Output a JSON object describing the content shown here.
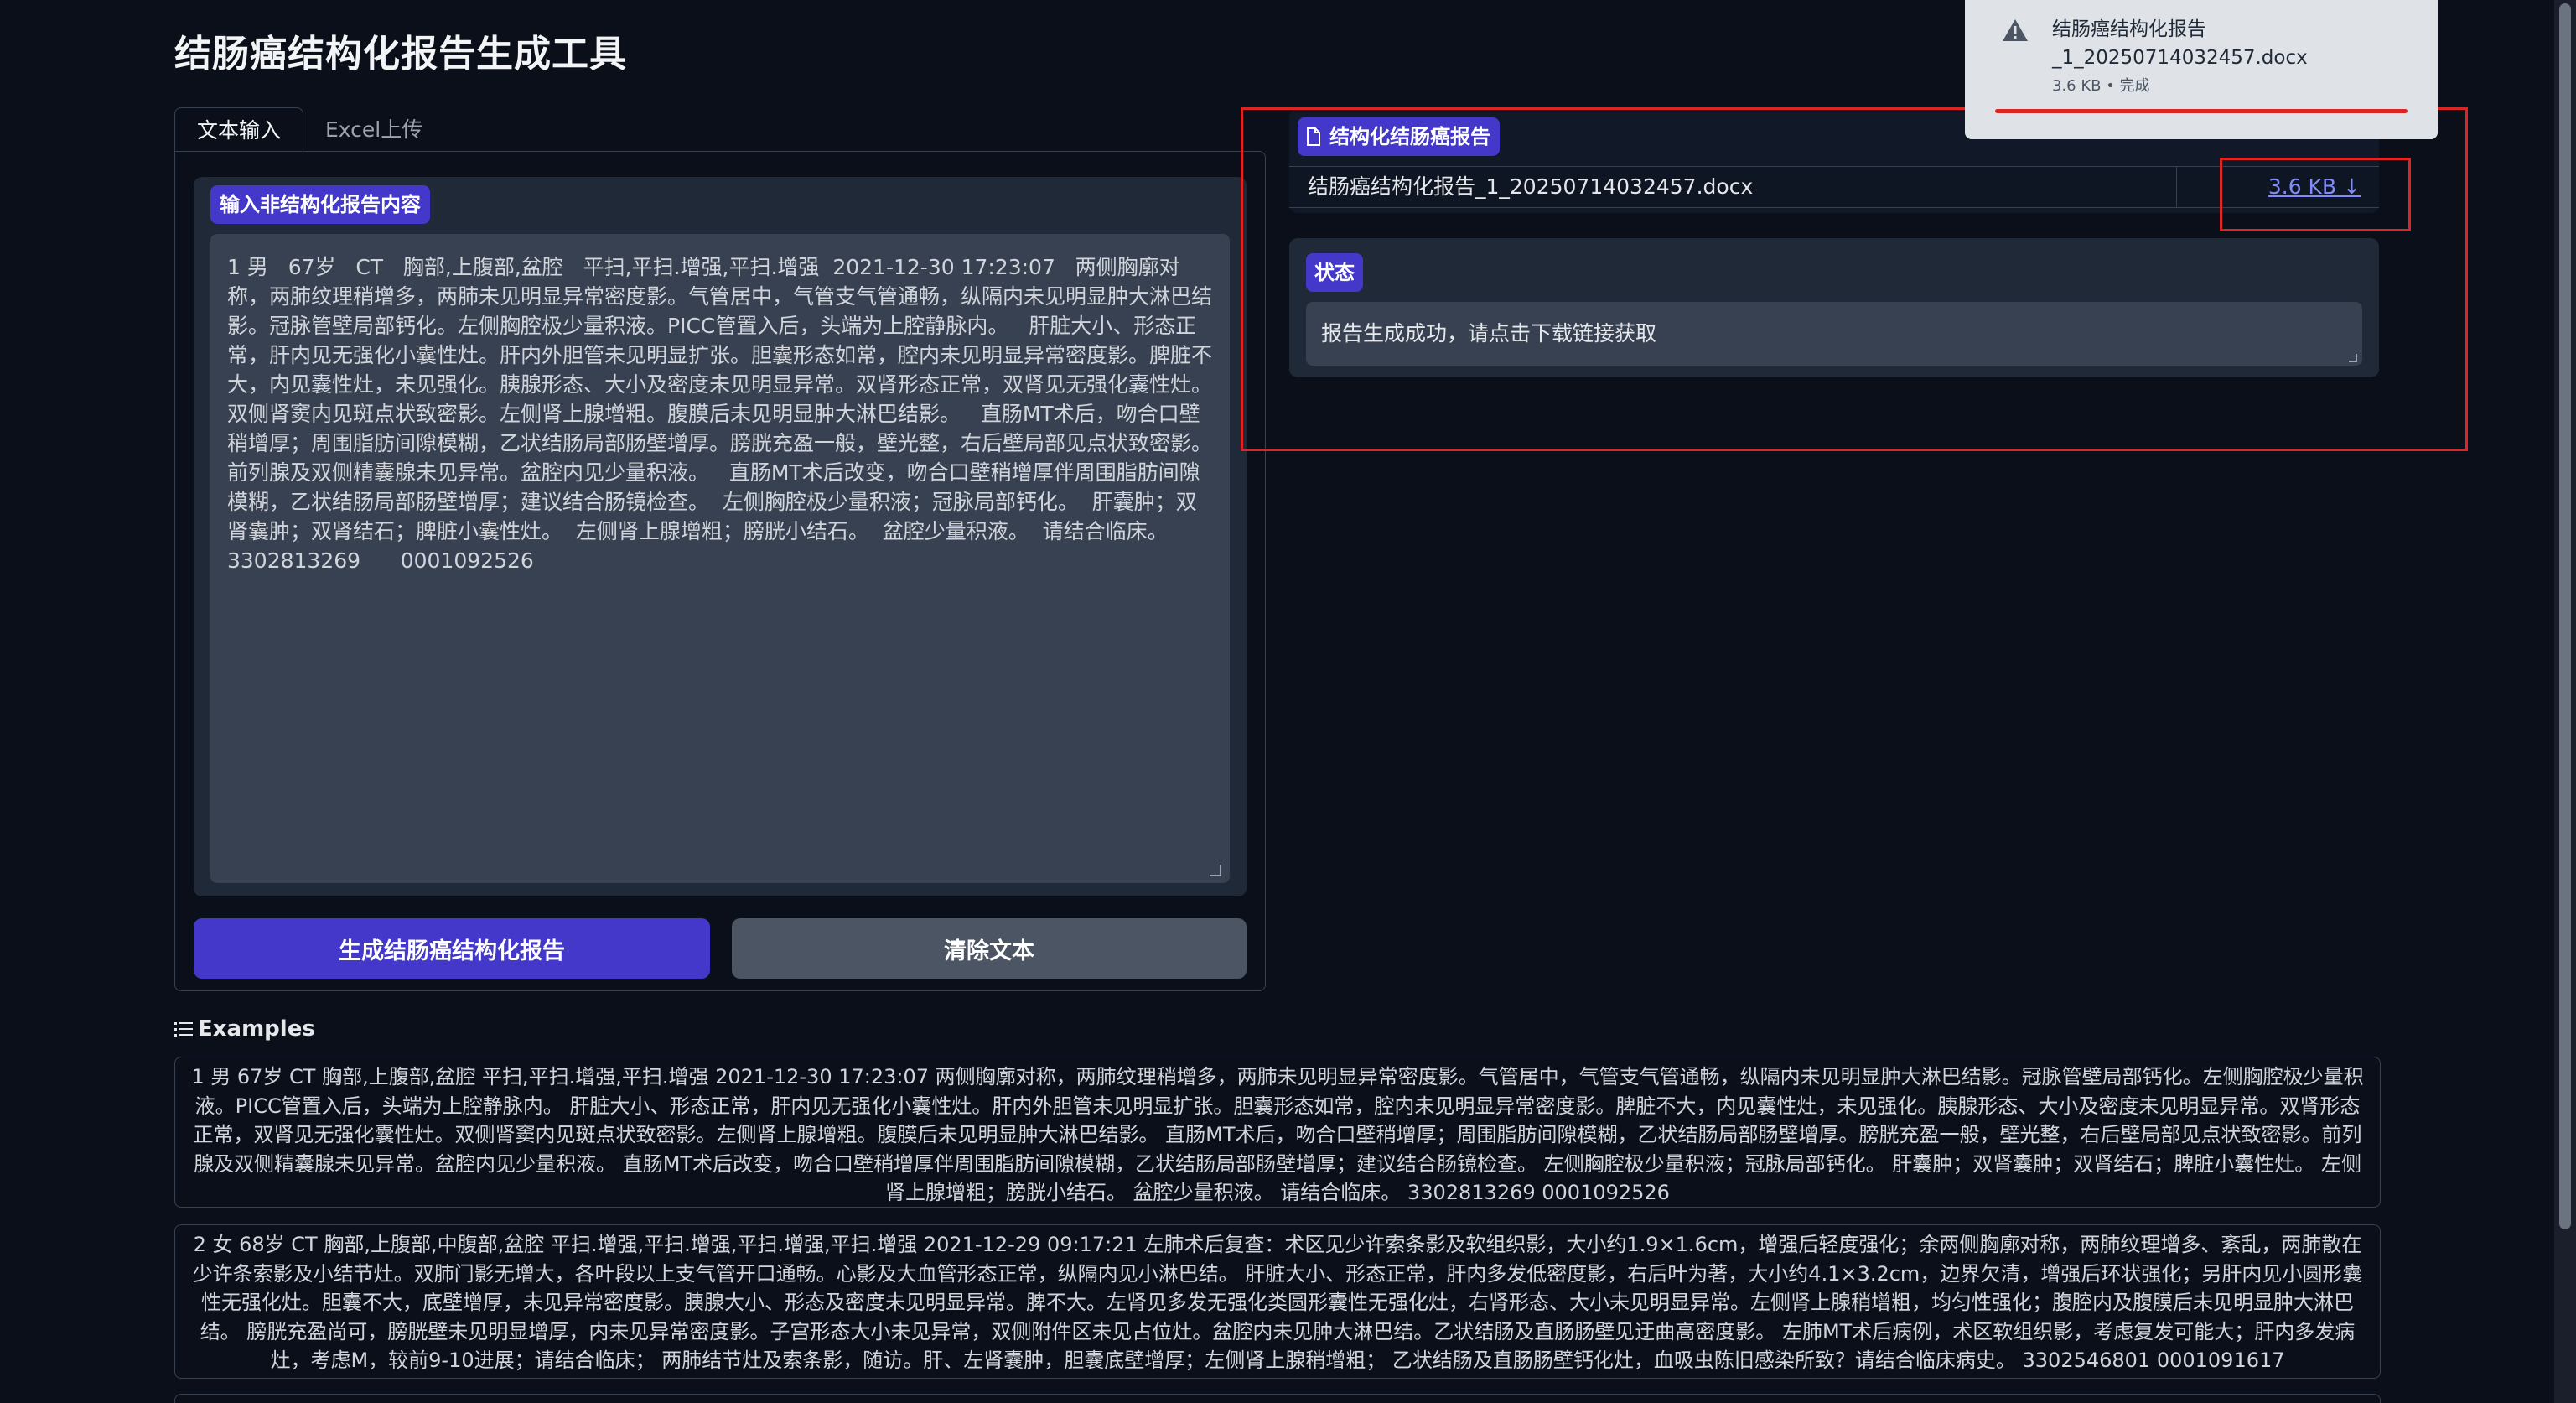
{
  "app": {
    "title": "结肠癌结构化报告生成工具"
  },
  "tabs": [
    {
      "label": "文本输入"
    },
    {
      "label": "Excel上传"
    }
  ],
  "input": {
    "label": "输入非结构化报告内容",
    "value": "1 男   67岁   CT   胸部,上腹部,盆腔   平扫,平扫.增强,平扫.增强  2021-12-30 17:23:07   两侧胸廓对称，两肺纹理稍增多，两肺未见明显异常密度影。气管居中，气管支气管通畅，纵隔内未见明显肿大淋巴结影。冠脉管壁局部钙化。左侧胸腔极少量积液。PICC管置入后，头端为上腔静脉内。   肝脏大小、形态正常，肝内见无强化小囊性灶。肝内外胆管未见明显扩张。胆囊形态如常，腔内未见明显异常密度影。脾脏不大，内见囊性灶，未见强化。胰腺形态、大小及密度未见明显异常。双肾形态正常，双肾见无强化囊性灶。双侧肾窦内见斑点状致密影。左侧肾上腺增粗。腹膜后未见明显肿大淋巴结影。   直肠MT术后，吻合口壁稍增厚；周围脂肪间隙模糊，乙状结肠局部肠壁增厚。膀胱充盈一般，壁光整，右后壁局部见点状致密影。前列腺及双侧精囊腺未见异常。盆腔内见少量积液。   直肠MT术后改变，吻合口壁稍增厚伴周围脂肪间隙模糊，乙状结肠局部肠壁增厚；建议结合肠镜检查。  左侧胸腔极少量积液；冠脉局部钙化。  肝囊肿；双肾囊肿；双肾结石；脾脏小囊性灶。  左侧肾上腺增粗；膀胱小结石。  盆腔少量积液。  请结合临床。   3302813269      0001092526"
  },
  "buttons": {
    "generate": "生成结肠癌结构化报告",
    "clear": "清除文本"
  },
  "output": {
    "label": "结构化结肠癌报告",
    "file_name": "结肠癌结构化报告_1_20250714032457.docx",
    "file_size": "3.6 KB ↓"
  },
  "status": {
    "label": "状态",
    "message": "报告生成成功，请点击下载链接获取"
  },
  "examples": {
    "label": "Examples",
    "items": [
      "1 男 67岁 CT 胸部,上腹部,盆腔 平扫,平扫.增强,平扫.增强 2021-12-30 17:23:07   两侧胸廓对称，两肺纹理稍增多，两肺未见明显异常密度影。气管居中，气管支气管通畅，纵隔内未见明显肿大淋巴结影。冠脉管壁局部钙化。左侧胸腔极少量积液。PICC管置入后，头端为上腔静脉内。   肝脏大小、形态正常，肝内见无强化小囊性灶。肝内外胆管未见明显扩张。胆囊形态如常，腔内未见明显异常密度影。脾脏不大，内见囊性灶，未见强化。胰腺形态、大小及密度未见明显异常。双肾形态正常，双肾见无强化囊性灶。双侧肾窦内见斑点状致密影。左侧肾上腺增粗。腹膜后未见明显肿大淋巴结影。   直肠MT术后，吻合口壁稍增厚；周围脂肪间隙模糊，乙状结肠局部肠壁增厚。膀胱充盈一般，壁光整，右后壁局部见点状致密影。前列腺及双侧精囊腺未见异常。盆腔内见少量积液。  直肠MT术后改变，吻合口壁稍增厚伴周围脂肪间隙模糊，乙状结肠局部肠壁增厚；建议结合肠镜检查。 左侧胸腔极少量积液；冠脉局部钙化。 肝囊肿；双肾囊肿；双肾结石；脾脏小囊性灶。 左侧肾上腺增粗；膀胱小结石。 盆腔少量积液。 请结合临床。 3302813269 0001092526",
      "2 女 68岁 CT 胸部,上腹部,中腹部,盆腔 平扫.增强,平扫.增强,平扫.增强,平扫.增强 2021-12-29 09:17:21       左肺术后复查：术区见少许索条影及软组织影，大小约1.9×1.6cm，增强后轻度强化；余两侧胸廓对称，两肺纹理增多、紊乱，两肺散在少许条索影及小结节灶。双肺门影无增大，各叶段以上支气管开口通畅。心影及大血管形态正常，纵隔内见小淋巴结。       肝脏大小、形态正常，肝内多发低密度影，右后叶为著，大小约4.1×3.2cm，边界欠清，增强后环状强化；另肝内见小圆形囊性无强化灶。胆囊不大，底壁增厚，未见异常密度影。胰腺大小、形态及密度未见明显异常。脾不大。左肾见多发无强化类圆形囊性无强化灶，右肾形态、大小未见明显异常。左侧肾上腺稍增粗，均匀性强化；腹腔内及腹膜后未见明显肿大淋巴结。       膀胱充盈尚可，膀胱壁未见明显增厚，内未见异常密度影。子宫形态大小未见异常，双侧附件区未见占位灶。盆腔内未见肿大淋巴结。乙状结肠及直肠肠壁见迂曲高密度影。 左肺MT术后病例，术区软组织影，考虑复发可能大；肝内多发病灶，考虑M，较前9-10进展；请结合临床； 两肺结节灶及索条影，随访。肝、左肾囊肿，胆囊底壁增厚；左侧肾上腺稍增粗； 乙状结肠及直肠肠壁钙化灶，血吸虫陈旧感染所致？请结合临床病史。 3302546801 0001091617"
    ]
  },
  "download": {
    "file_name": "结肠癌结构化报告_1_20250714032457.docx",
    "meta": "3.6 KB • 完成"
  },
  "colors": {
    "background": "#0b0f19",
    "accent": "#4338ca",
    "link": "#818cf8",
    "highlight": "#dc2626"
  }
}
